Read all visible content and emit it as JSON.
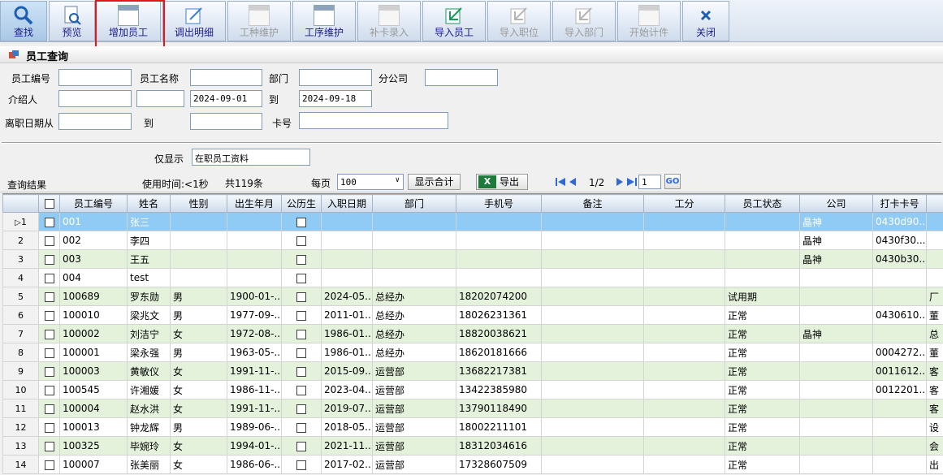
{
  "toolbar": [
    {
      "label": "查找",
      "icon": "search-icon",
      "enabled": true
    },
    {
      "label": "预览",
      "icon": "preview-icon",
      "enabled": true
    },
    {
      "label": "增加员工",
      "icon": "window-icon",
      "enabled": true
    },
    {
      "label": "调出明细",
      "icon": "edit-icon",
      "enabled": true
    },
    {
      "label": "工种维护",
      "icon": "window-icon",
      "enabled": false
    },
    {
      "label": "工序维护",
      "icon": "window-icon",
      "enabled": true
    },
    {
      "label": "补卡录入",
      "icon": "window-icon",
      "enabled": false
    },
    {
      "label": "导入员工",
      "icon": "import-icon",
      "enabled": true
    },
    {
      "label": "导入职位",
      "icon": "import-icon",
      "enabled": false
    },
    {
      "label": "导入部门",
      "icon": "import-icon",
      "enabled": false
    },
    {
      "label": "开始计件",
      "icon": "window-icon",
      "enabled": false
    },
    {
      "label": "关闭",
      "icon": "close-icon",
      "enabled": true
    }
  ],
  "query": {
    "title": "员工查询",
    "emp_no_label": "员工编号",
    "emp_name_label": "员工名称",
    "dept_label": "部门",
    "branch_label": "分公司",
    "referrer_label": "介绍人",
    "date_from": "2024-09-01",
    "to_label": "到",
    "date_to": "2024-09-18",
    "leave_date_label": "离职日期从",
    "leave_to_label": "到",
    "card_label": "卡号",
    "only_show_label": "仅显示",
    "only_show_value": "在职员工资料"
  },
  "results": {
    "title": "查询结果",
    "time_used": "使用时间:<1秒",
    "total": "共119条",
    "per_page_label": "每页",
    "per_page_value": "100",
    "sum_button": "显示合计",
    "export_button": "导出",
    "page_info": "1/2",
    "page_input": "1",
    "go_label": "GO"
  },
  "grid": {
    "columns": [
      "员工编号",
      "姓名",
      "性别",
      "出生年月",
      "公历生",
      "入职日期",
      "部门",
      "手机号",
      "备注",
      "工分",
      "员工状态",
      "公司",
      "打卡卡号"
    ],
    "rows": [
      {
        "n": "1",
        "id": "001",
        "name": "张三",
        "sex": "",
        "birth": "",
        "join": "",
        "dept": "",
        "phone": "",
        "status": "",
        "company": "晶神",
        "card": "0430d90...",
        "extra": ""
      },
      {
        "n": "2",
        "id": "002",
        "name": "李四",
        "sex": "",
        "birth": "",
        "join": "",
        "dept": "",
        "phone": "",
        "status": "",
        "company": "晶神",
        "card": "0430f30...",
        "extra": ""
      },
      {
        "n": "3",
        "id": "003",
        "name": "王五",
        "sex": "",
        "birth": "",
        "join": "",
        "dept": "",
        "phone": "",
        "status": "",
        "company": "晶神",
        "card": "0430b30...",
        "extra": ""
      },
      {
        "n": "4",
        "id": "004",
        "name": "test",
        "sex": "",
        "birth": "",
        "join": "",
        "dept": "",
        "phone": "",
        "status": "",
        "company": "",
        "card": "",
        "extra": ""
      },
      {
        "n": "5",
        "id": "100689",
        "name": "罗东勋",
        "sex": "男",
        "birth": "1900-01-...",
        "join": "2024-05...",
        "dept": "总经办",
        "phone": "18202074200",
        "status": "试用期",
        "company": "",
        "card": "",
        "extra": "厂"
      },
      {
        "n": "6",
        "id": "100010",
        "name": "梁兆文",
        "sex": "男",
        "birth": "1977-09-...",
        "join": "2011-01...",
        "dept": "总经办",
        "phone": "18026231361",
        "status": "正常",
        "company": "",
        "card": "0430610...",
        "extra": "董"
      },
      {
        "n": "7",
        "id": "100002",
        "name": "刘洁宁",
        "sex": "女",
        "birth": "1972-08-...",
        "join": "1986-01...",
        "dept": "总经办",
        "phone": "18820038621",
        "status": "正常",
        "company": "晶神",
        "card": "",
        "extra": "总"
      },
      {
        "n": "8",
        "id": "100001",
        "name": "梁永强",
        "sex": "男",
        "birth": "1963-05-...",
        "join": "1986-01...",
        "dept": "总经办",
        "phone": "18620181666",
        "status": "正常",
        "company": "",
        "card": "0004272...",
        "extra": "董"
      },
      {
        "n": "9",
        "id": "100003",
        "name": "黄敏仪",
        "sex": "女",
        "birth": "1991-11-...",
        "join": "2015-09...",
        "dept": "运营部",
        "phone": "13682217381",
        "status": "正常",
        "company": "",
        "card": "0011612...",
        "extra": "客"
      },
      {
        "n": "10",
        "id": "100545",
        "name": "许湘媛",
        "sex": "女",
        "birth": "1986-11-...",
        "join": "2023-04...",
        "dept": "运营部",
        "phone": "13422385980",
        "status": "正常",
        "company": "",
        "card": "0012201...",
        "extra": "客"
      },
      {
        "n": "11",
        "id": "100004",
        "name": "赵水洪",
        "sex": "女",
        "birth": "1991-11-...",
        "join": "2019-07...",
        "dept": "运营部",
        "phone": "13790118490",
        "status": "正常",
        "company": "",
        "card": "",
        "extra": "客"
      },
      {
        "n": "12",
        "id": "100013",
        "name": "钟龙辉",
        "sex": "男",
        "birth": "1989-06-...",
        "join": "2018-05...",
        "dept": "运营部",
        "phone": "18002211101",
        "status": "正常",
        "company": "",
        "card": "",
        "extra": "设"
      },
      {
        "n": "13",
        "id": "100325",
        "name": "毕婉玲",
        "sex": "女",
        "birth": "1994-01-...",
        "join": "2021-11...",
        "dept": "运营部",
        "phone": "18312034616",
        "status": "正常",
        "company": "",
        "card": "",
        "extra": "会"
      },
      {
        "n": "14",
        "id": "100007",
        "name": "张美丽",
        "sex": "女",
        "birth": "1986-06-...",
        "join": "2017-02...",
        "dept": "运营部",
        "phone": "17328607509",
        "status": "正常",
        "company": "",
        "card": "",
        "extra": "出"
      }
    ]
  }
}
